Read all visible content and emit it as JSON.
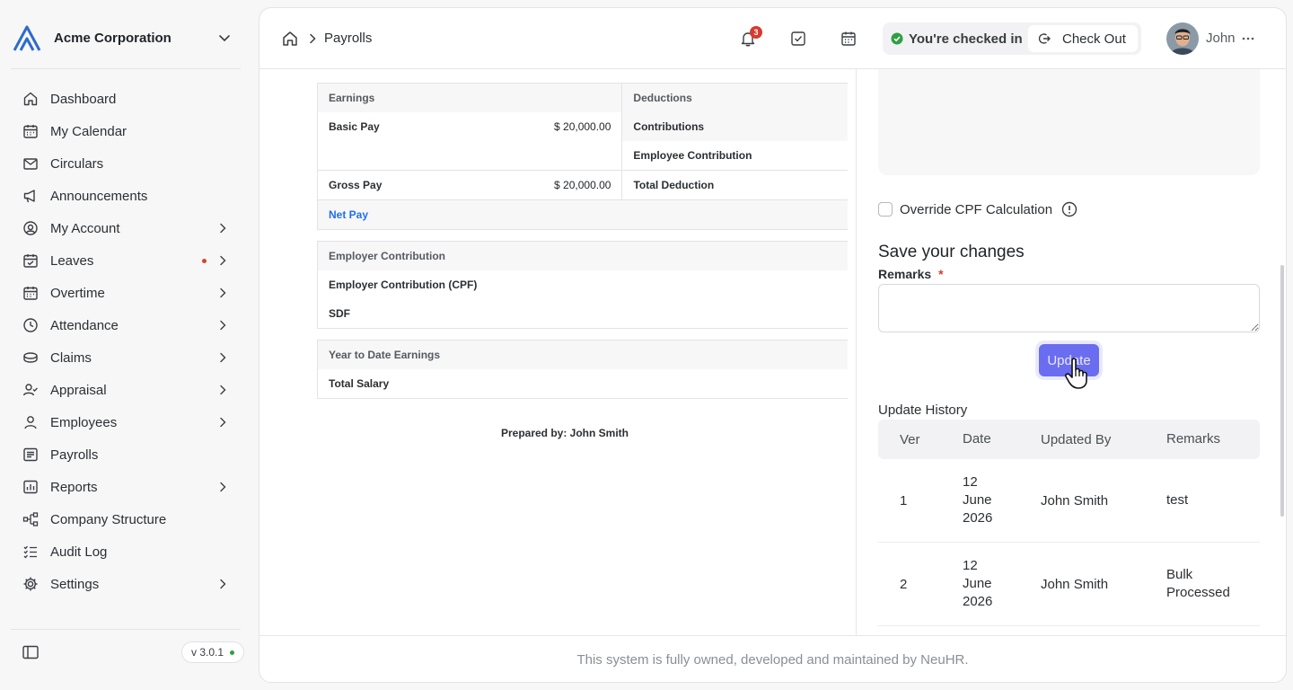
{
  "org": {
    "name": "Acme Corporation",
    "logo": "acme-logo"
  },
  "nav": {
    "items": [
      {
        "label": "Dashboard",
        "icon": "home-icon"
      },
      {
        "label": "My Calendar",
        "icon": "calendar-icon"
      },
      {
        "label": "Circulars",
        "icon": "mail-icon"
      },
      {
        "label": "Announcements",
        "icon": "megaphone-icon"
      },
      {
        "label": "My Account",
        "icon": "user-circle-icon"
      },
      {
        "label": "Leaves",
        "icon": "calendar-check-icon"
      },
      {
        "label": "Overtime",
        "icon": "calendar-icon"
      },
      {
        "label": "Attendance",
        "icon": "clock-icon"
      },
      {
        "label": "Claims",
        "icon": "coins-icon"
      },
      {
        "label": "Appraisal",
        "icon": "user-check-icon"
      },
      {
        "label": "Employees",
        "icon": "user-icon"
      },
      {
        "label": "Payrolls",
        "icon": "receipt-icon"
      },
      {
        "label": "Reports",
        "icon": "chart-icon"
      },
      {
        "label": "Company Structure",
        "icon": "hierarchy-icon"
      },
      {
        "label": "Audit Log",
        "icon": "checklist-icon"
      },
      {
        "label": "Settings",
        "icon": "gear-icon"
      }
    ]
  },
  "version": "v 3.0.1",
  "header": {
    "breadcrumb": "Payrolls",
    "notification_count": "3",
    "checkin_status": "You're checked in",
    "checkout_label": "Check Out",
    "user_name": "John"
  },
  "payslip": {
    "earnings_header": "Earnings",
    "deductions_header": "Deductions",
    "basic_pay_label": "Basic Pay",
    "basic_pay_value": "$ 20,000.00",
    "contributions_label": "Contributions",
    "employee_contribution_label": "Employee Contribution",
    "gross_pay_label": "Gross Pay",
    "gross_pay_value": "$ 20,000.00",
    "total_deduction_label": "Total Deduction",
    "net_pay_label": "Net Pay",
    "employer_contribution_header": "Employer Contribution",
    "employer_cpf_label": "Employer Contribution (CPF)",
    "sdf_label": "SDF",
    "ytd_header": "Year to Date Earnings",
    "total_salary_label": "Total Salary",
    "prepared_by": "Prepared by: John Smith"
  },
  "form": {
    "override_label": "Override CPF Calculation",
    "save_title": "Save your changes",
    "remarks_label": "Remarks",
    "required_mark": "*",
    "remarks_value": "",
    "update_label": "Update"
  },
  "history": {
    "title": "Update History",
    "columns": [
      "Ver",
      "Date",
      "Updated By",
      "Remarks"
    ],
    "rows": [
      {
        "ver": "1",
        "date_line1": "12",
        "date_line2": "June",
        "date_line3": "2026",
        "by": "John Smith",
        "rem_line1": "test",
        "rem_line2": ""
      },
      {
        "ver": "2",
        "date_line1": "12",
        "date_line2": "June",
        "date_line3": "2026",
        "by": "John Smith",
        "rem_line1": "Bulk",
        "rem_line2": "Processed"
      }
    ]
  },
  "footer": "This system is fully owned, developed and maintained by NeuHR.",
  "colors": {
    "accent": "#6b6df0",
    "link": "#1f6feb",
    "success": "#2ea043",
    "danger": "#d73a2f"
  }
}
